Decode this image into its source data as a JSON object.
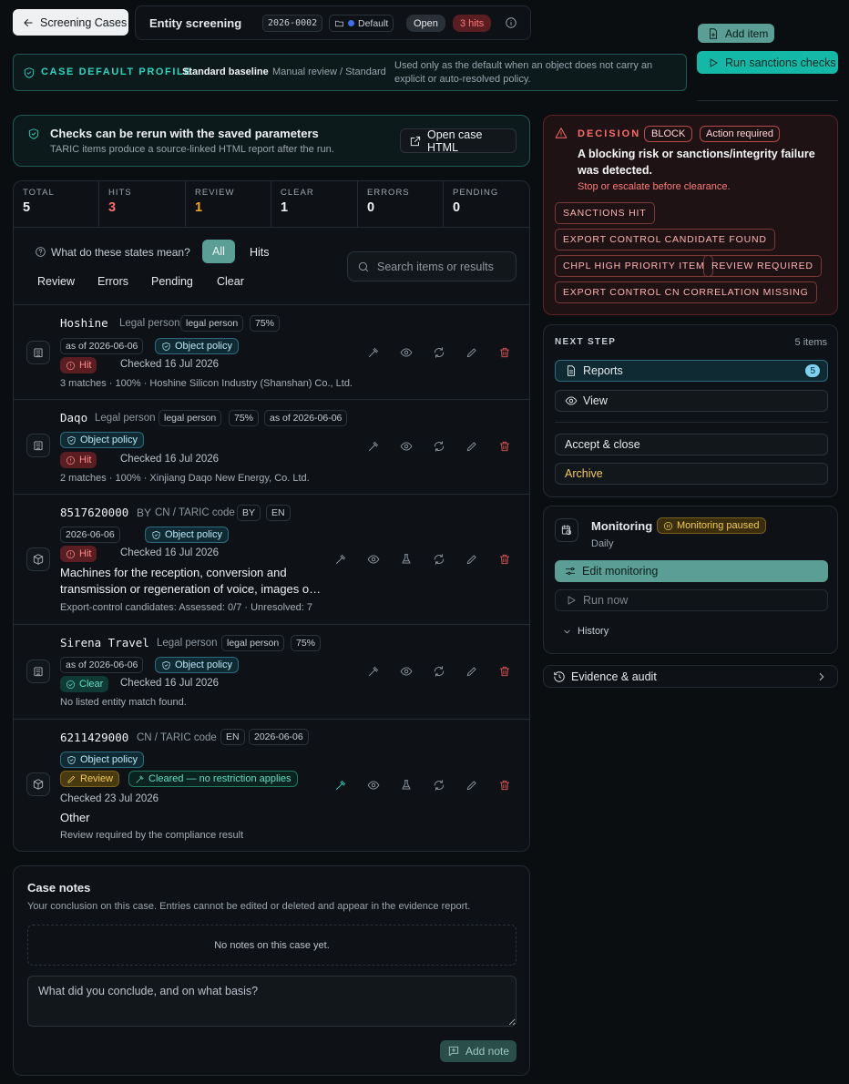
{
  "header": {
    "back_label": "Screening Cases",
    "title": "Entity screening",
    "case_id": "2026-0002",
    "folder": "Default",
    "status": "Open",
    "hits": "3 hits"
  },
  "toolbar": {
    "add_item": "Add item",
    "run_checks": "Run sanctions checks"
  },
  "profile": {
    "label": "CASE DEFAULT PROFILE",
    "name": "Standard baseline",
    "mode": "Manual review / Standard",
    "note": "Used only as the default when an object does not carry an explicit or auto-resolved policy."
  },
  "rerun": {
    "title": "Checks can be rerun with the saved parameters",
    "subtitle": "TARIC items produce a source-linked HTML report after the run.",
    "open_html": "Open case HTML"
  },
  "stats": [
    {
      "label": "TOTAL",
      "value": "5",
      "color": "#eef1f3"
    },
    {
      "label": "HITS",
      "value": "3",
      "color": "#ff6b6b"
    },
    {
      "label": "REVIEW",
      "value": "1",
      "color": "#f5a623"
    },
    {
      "label": "CLEAR",
      "value": "1",
      "color": "#eef1f3"
    },
    {
      "label": "ERRORS",
      "value": "0",
      "color": "#eef1f3"
    },
    {
      "label": "PENDING",
      "value": "0",
      "color": "#eef1f3"
    }
  ],
  "filters": {
    "help": "What do these states mean?",
    "all": "All",
    "hits": "Hits",
    "review": "Review",
    "errors": "Errors",
    "pending": "Pending",
    "clear": "Clear",
    "search_placeholder": "Search items or results"
  },
  "items": [
    {
      "name": "Hoshine",
      "type": "Legal person",
      "tag1": "legal person",
      "tag2": "75%",
      "asof": "as of 2026-06-06",
      "policy": "Object policy",
      "state": "Hit",
      "checked": "Checked 16 Jul 2026",
      "detail": "3 matches · 100% · Hoshine Silicon Industry (Shanshan) Co., Ltd."
    },
    {
      "name": "Daqo",
      "type": "Legal person",
      "tag1": "legal person",
      "tag2": "75%",
      "asof": "as of 2026-06-06",
      "policy": "Object policy",
      "state": "Hit",
      "checked": "Checked 16 Jul 2026",
      "detail": "2 matches · 100% · Xinjiang Daqo New Energy, Co. Ltd."
    },
    {
      "name": "8517620000",
      "country": "BY",
      "type": "CN / TARIC code",
      "lang": "EN",
      "date": "2026-06-06",
      "policy": "Object policy",
      "state": "Hit",
      "checked": "Checked 16 Jul 2026",
      "desc": "Machines for the reception, conversion and transmission or regeneration of voice, images o…",
      "detail": "Export-control candidates: Assessed: 0/7 · Unresolved: 7"
    },
    {
      "name": "Sirena Travel",
      "type": "Legal person",
      "tag1": "legal person",
      "tag2": "75%",
      "asof": "as of 2026-06-06",
      "policy": "Object policy",
      "state": "Clear",
      "checked": "Checked 16 Jul 2026",
      "detail": "No listed entity match found."
    },
    {
      "name": "6211429000",
      "type": "CN / TARIC code",
      "lang": "EN",
      "date": "2026-06-06",
      "policy": "Object policy",
      "state": "Review",
      "cleared": "Cleared — no restriction applies",
      "checked": "Checked 23 Jul 2026",
      "desc": "Other",
      "detail": "Review required by the compliance result"
    }
  ],
  "notes": {
    "title": "Case notes",
    "subtitle": "Your conclusion on this case. Entries cannot be edited or deleted and appear in the evidence report.",
    "empty": "No notes on this case yet.",
    "placeholder": "What did you conclude, and on what basis?",
    "add": "Add note"
  },
  "decision": {
    "label": "DECISION",
    "verdict": "BLOCK",
    "action": "Action required",
    "headline": "A blocking risk or sanctions/integrity failure was detected.",
    "sub": "Stop or escalate before clearance.",
    "tags": [
      "SANCTIONS HIT",
      "EXPORT CONTROL CANDIDATE FOUND",
      "CHPL HIGH PRIORITY ITEM",
      "REVIEW REQUIRED",
      "EXPORT CONTROL CN CORRELATION MISSING"
    ]
  },
  "next_step": {
    "label": "NEXT STEP",
    "count": "5 items",
    "reports": "Reports",
    "reports_badge": "5",
    "view": "View",
    "accept": "Accept & close",
    "archive": "Archive"
  },
  "monitoring": {
    "title": "Monitoring",
    "status": "Monitoring paused",
    "frequency": "Daily",
    "edit": "Edit monitoring",
    "run_now": "Run now",
    "history": "History"
  },
  "evidence": {
    "label": "Evidence & audit"
  },
  "colors": {
    "accent": "#5aa89d",
    "teal": "#14b8a6",
    "danger": "#ff6b6b",
    "warn": "#f3cb55"
  }
}
